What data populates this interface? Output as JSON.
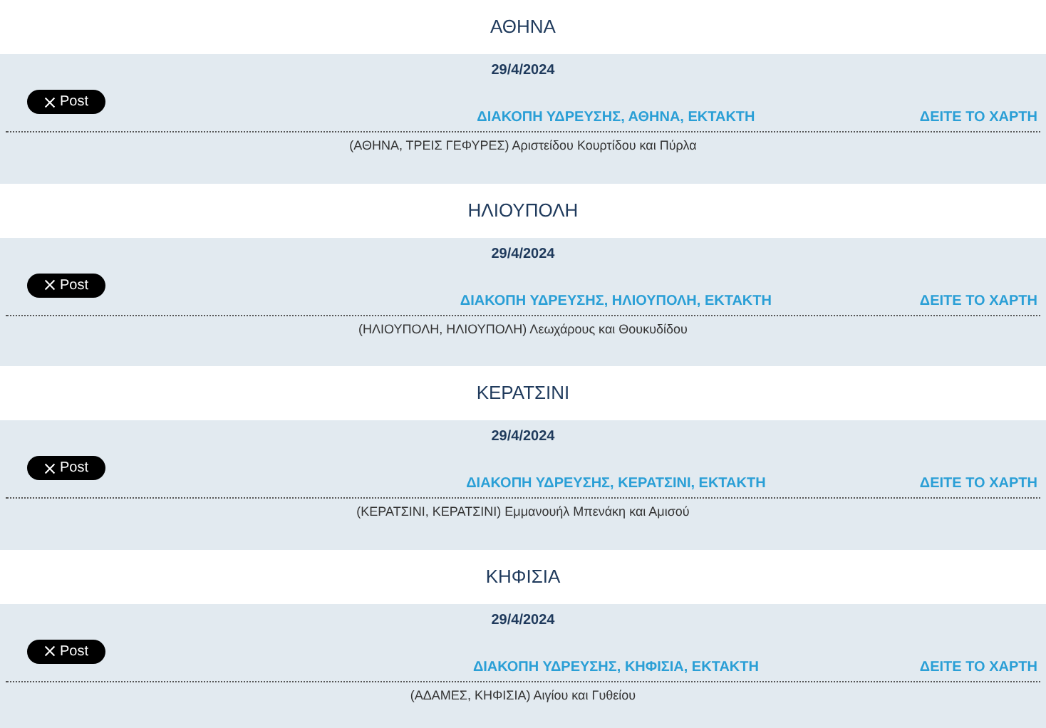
{
  "sections": [
    {
      "area": "ΑΘΗΝΑ",
      "date": "29/4/2024",
      "post_button": "Post",
      "title": "ΔΙΑΚΟΠΗ ΥΔΡΕΥΣΗΣ, ΑΘΗΝΑ, ΕΚΤΑΚΤΗ",
      "map_link": "ΔΕΙΤΕ ΤΟ ΧΑΡΤΗ",
      "details": "(ΑΘΗΝΑ, ΤΡΕΙΣ ΓΕΦΥΡΕΣ) Αριστείδου Κουρτίδου και Πύρλα"
    },
    {
      "area": "ΗΛΙΟΥΠΟΛΗ",
      "date": "29/4/2024",
      "post_button": "Post",
      "title": "ΔΙΑΚΟΠΗ ΥΔΡΕΥΣΗΣ, ΗΛΙΟΥΠΟΛΗ, ΕΚΤΑΚΤΗ",
      "map_link": "ΔΕΙΤΕ ΤΟ ΧΑΡΤΗ",
      "details": "(ΗΛΙΟΥΠΟΛΗ, ΗΛΙΟΥΠΟΛΗ) Λεωχάρους και Θουκυδίδου"
    },
    {
      "area": "ΚΕΡΑΤΣΙΝΙ",
      "date": "29/4/2024",
      "post_button": "Post",
      "title": "ΔΙΑΚΟΠΗ ΥΔΡΕΥΣΗΣ, ΚΕΡΑΤΣΙΝΙ, ΕΚΤΑΚΤΗ",
      "map_link": "ΔΕΙΤΕ ΤΟ ΧΑΡΤΗ",
      "details": "(ΚΕΡΑΤΣΙΝΙ, ΚΕΡΑΤΣΙΝΙ) Εμμανουήλ Μπενάκη και Αμισού"
    },
    {
      "area": "ΚΗΦΙΣΙΑ",
      "date": "29/4/2024",
      "post_button": "Post",
      "title": "ΔΙΑΚΟΠΗ ΥΔΡΕΥΣΗΣ, ΚΗΦΙΣΙΑ, ΕΚΤΑΚΤΗ",
      "map_link": "ΔΕΙΤΕ ΤΟ ΧΑΡΤΗ",
      "details": "(ΑΔΑΜΕΣ, ΚΗΦΙΣΙΑ) Αιγίου και Γυθείου"
    }
  ]
}
